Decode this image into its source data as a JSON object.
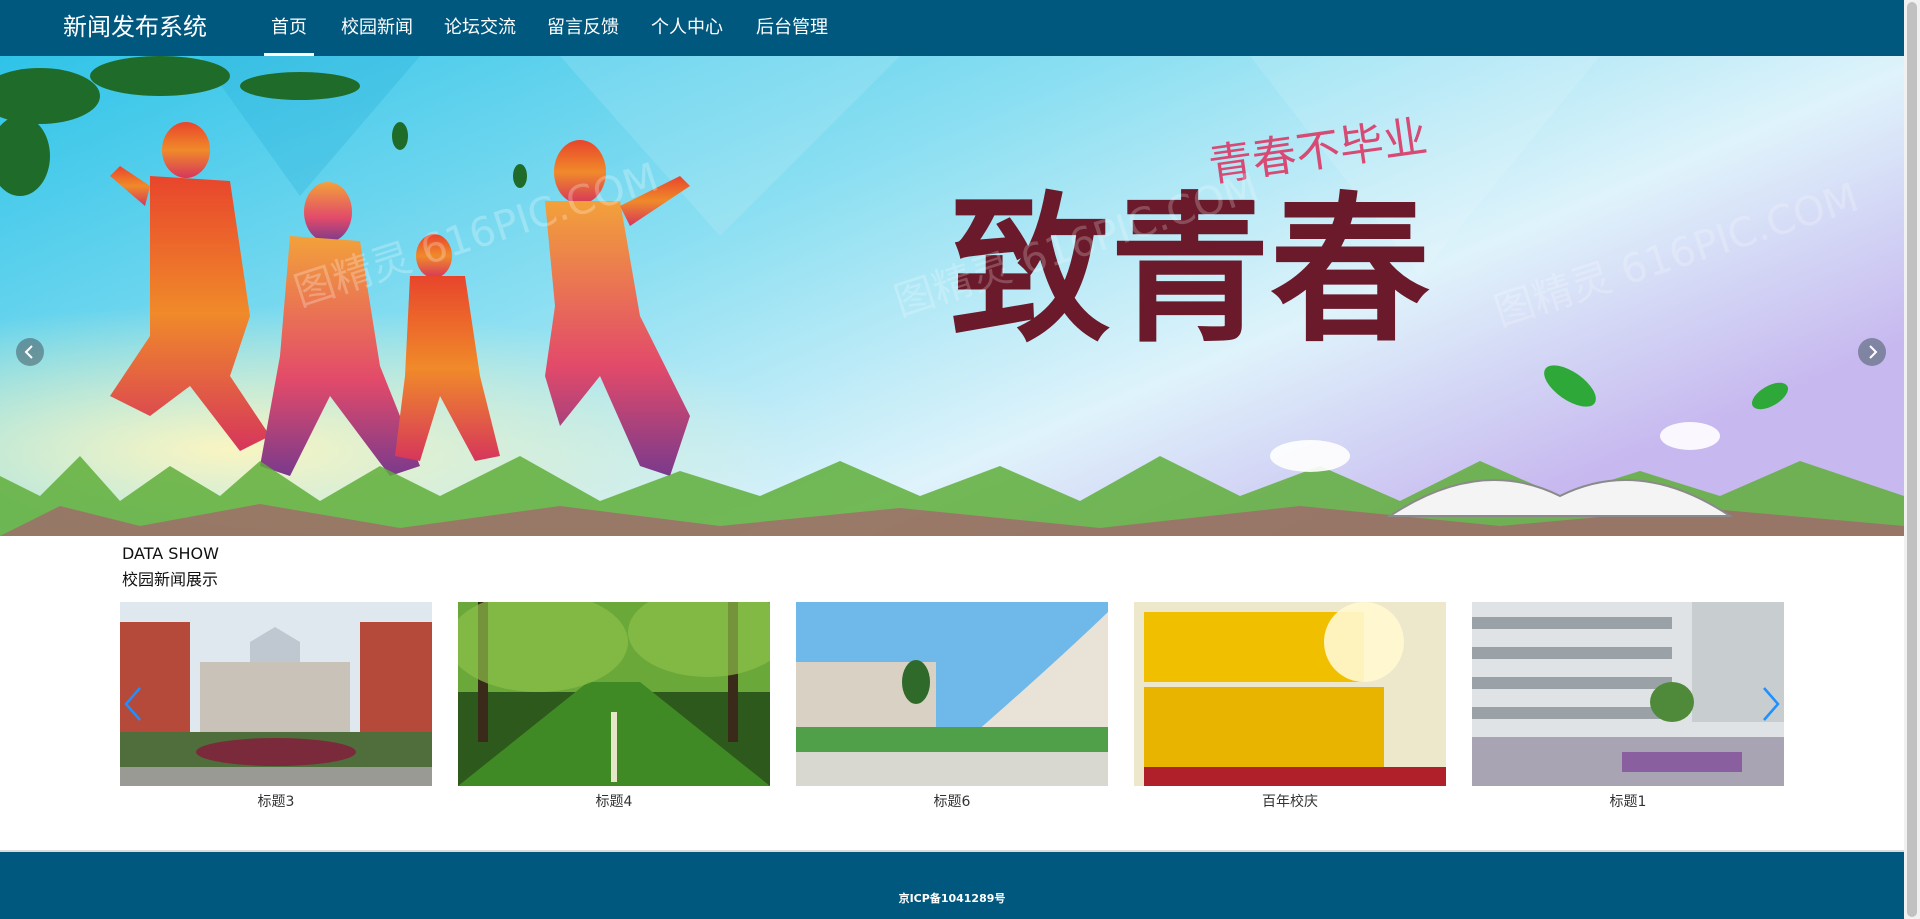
{
  "header": {
    "brand": "新闻发布系统",
    "nav": [
      {
        "label": "首页",
        "active": true
      },
      {
        "label": "校园新闻",
        "active": false
      },
      {
        "label": "论坛交流",
        "active": false
      },
      {
        "label": "留言反馈",
        "active": false
      },
      {
        "label": "个人中心",
        "active": false
      },
      {
        "label": "后台管理",
        "active": false
      }
    ]
  },
  "banner": {
    "headline": "致青春",
    "tagline": "青春不毕业",
    "watermark": "图精灵 616PIC.COM",
    "prev_icon": "chevron-left-icon",
    "next_icon": "chevron-right-icon"
  },
  "section": {
    "title_en": "DATA SHOW",
    "title_cn": "校园新闻展示"
  },
  "news_cards": [
    {
      "title": "标题3"
    },
    {
      "title": "标题4"
    },
    {
      "title": "标题6"
    },
    {
      "title": "百年校庆"
    },
    {
      "title": "标题1"
    }
  ],
  "footer": {
    "icp": "京ICP备1041289号"
  },
  "colors": {
    "primary": "#00587f",
    "carousel_arrow": "#1e90ff"
  }
}
